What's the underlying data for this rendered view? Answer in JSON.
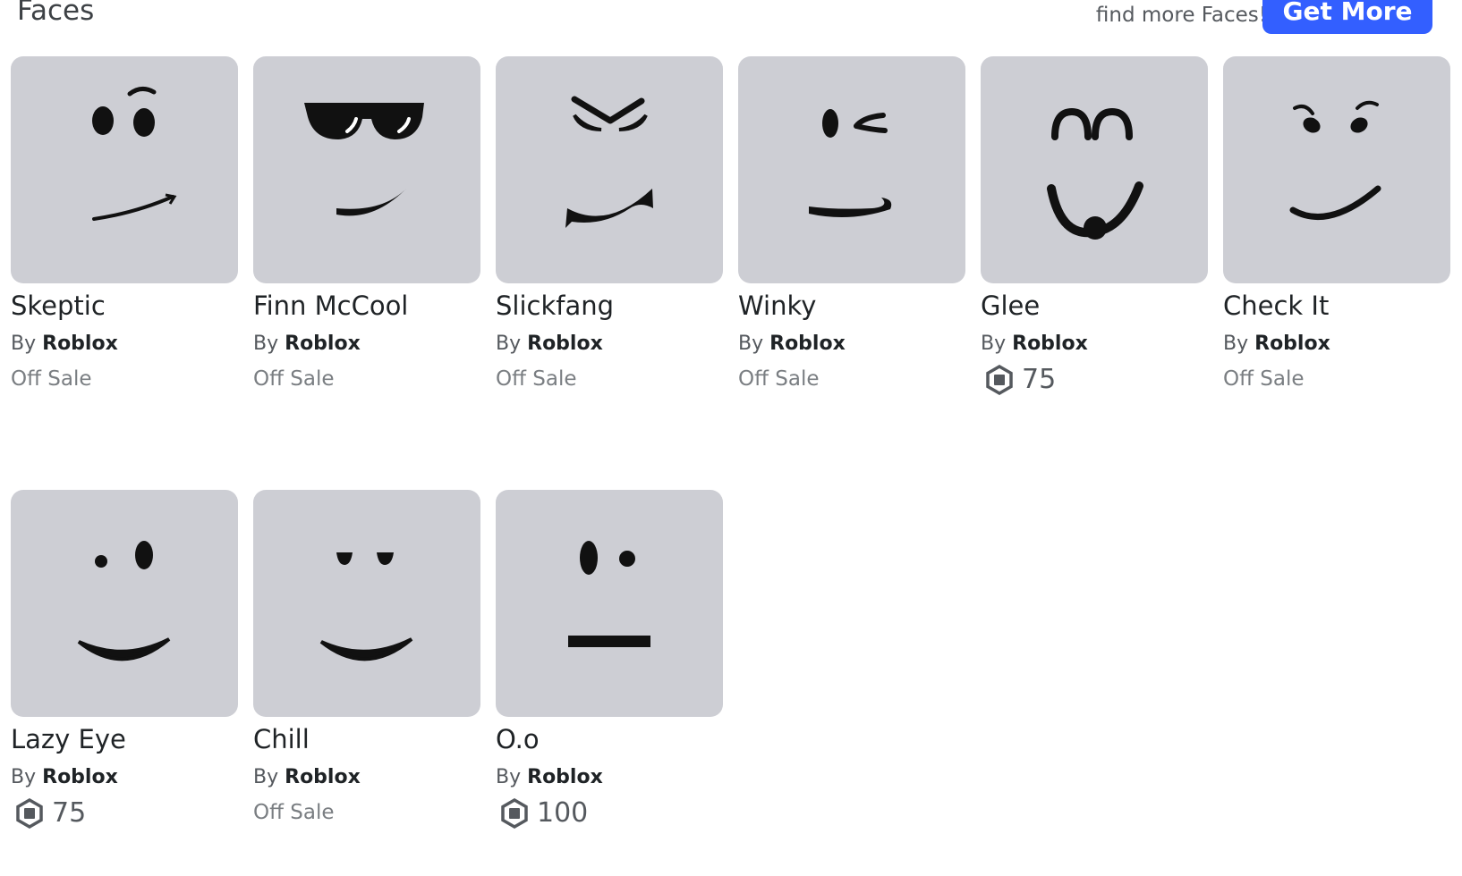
{
  "header": {
    "title": "Faces",
    "find_more_text": "find more Faces!",
    "get_more_label": "Get More"
  },
  "items": [
    {
      "name": "Skeptic",
      "by": "By",
      "creator": "Roblox",
      "price_text": "Off Sale",
      "robux": null,
      "icon": "skeptic-face-icon"
    },
    {
      "name": "Finn McCool",
      "by": "By",
      "creator": "Roblox",
      "price_text": "Off Sale",
      "robux": null,
      "icon": "finn-mccool-face-icon"
    },
    {
      "name": "Slickfang",
      "by": "By",
      "creator": "Roblox",
      "price_text": "Off Sale",
      "robux": null,
      "icon": "slickfang-face-icon"
    },
    {
      "name": "Winky",
      "by": "By",
      "creator": "Roblox",
      "price_text": "Off Sale",
      "robux": null,
      "icon": "winky-face-icon"
    },
    {
      "name": "Glee",
      "by": "By",
      "creator": "Roblox",
      "price_text": null,
      "robux": "75",
      "icon": "glee-face-icon"
    },
    {
      "name": "Check It",
      "by": "By",
      "creator": "Roblox",
      "price_text": "Off Sale",
      "robux": null,
      "icon": "check-it-face-icon"
    },
    {
      "name": "Lazy Eye",
      "by": "By",
      "creator": "Roblox",
      "price_text": null,
      "robux": "75",
      "icon": "lazy-eye-face-icon"
    },
    {
      "name": "Chill",
      "by": "By",
      "creator": "Roblox",
      "price_text": "Off Sale",
      "robux": null,
      "icon": "chill-face-icon"
    },
    {
      "name": "O.o",
      "by": "By",
      "creator": "Roblox",
      "price_text": null,
      "robux": "100",
      "icon": "o-o-face-icon"
    }
  ],
  "colors": {
    "accent": "#335fff",
    "thumb_bg": "#cdced4",
    "text_primary": "#1f2326",
    "text_secondary": "#55595e"
  }
}
